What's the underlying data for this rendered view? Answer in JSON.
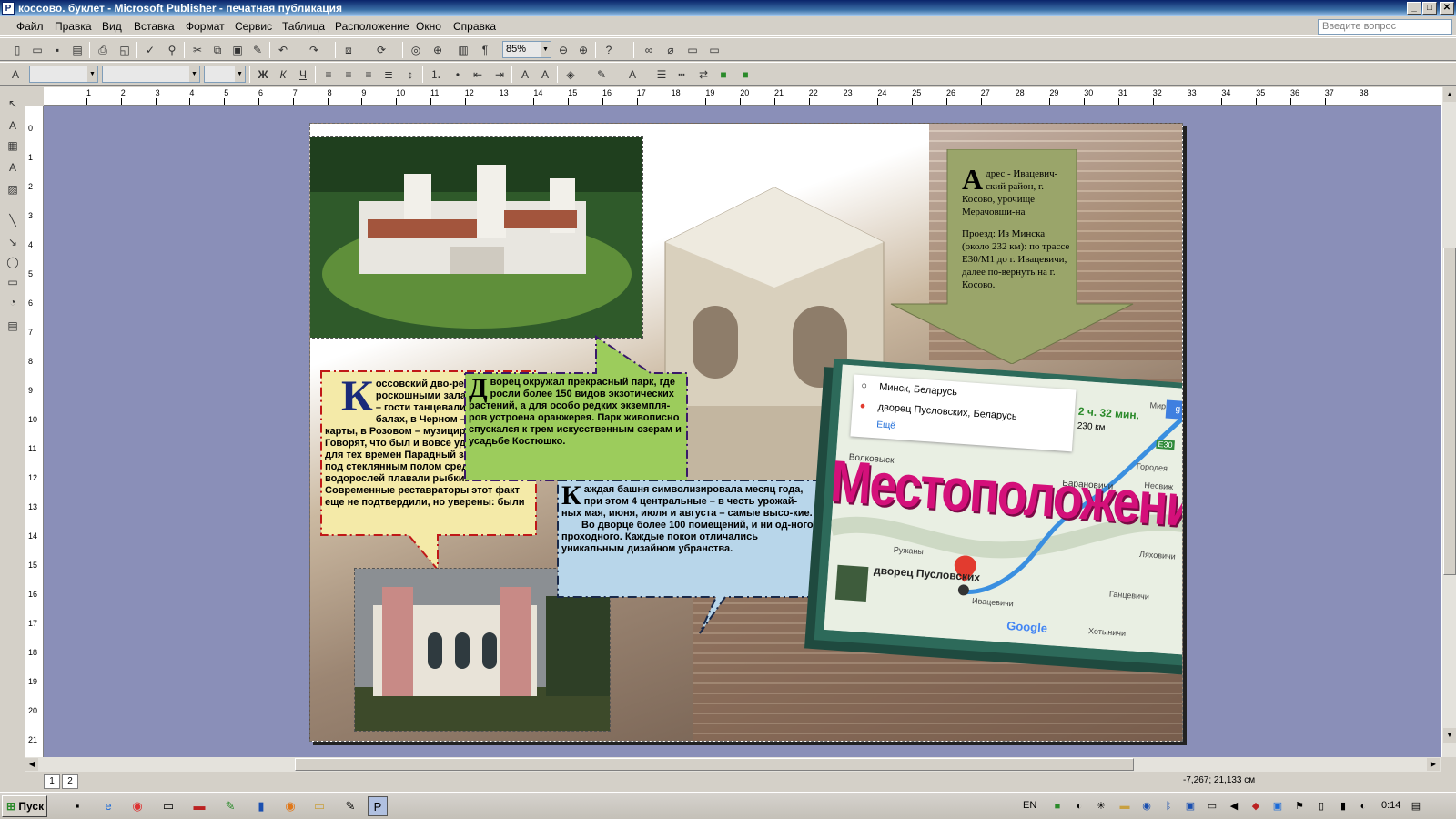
{
  "window": {
    "title": "коссово. буклет - Microsoft Publisher - печатная публикация",
    "app_icon": "publisher-icon"
  },
  "menu": {
    "items": [
      "Файл",
      "Правка",
      "Вид",
      "Вставка",
      "Формат",
      "Сервис",
      "Таблица",
      "Расположение",
      "Окно",
      "Справка"
    ],
    "ask_placeholder": "Введите вопрос"
  },
  "toolbar": {
    "zoom": "85%"
  },
  "rulers": {
    "h": [
      "1",
      "2",
      "3",
      "4",
      "5",
      "6",
      "7",
      "8",
      "9",
      "10",
      "11",
      "12",
      "13",
      "14",
      "15",
      "16",
      "17",
      "18",
      "19",
      "20",
      "21",
      "22",
      "23",
      "24",
      "25",
      "26",
      "27",
      "28",
      "29",
      "30",
      "31",
      "32",
      "33",
      "34",
      "35",
      "36",
      "37",
      "38"
    ],
    "v": [
      "0",
      "1",
      "2",
      "3",
      "4",
      "5",
      "6",
      "7",
      "8",
      "9",
      "10",
      "11",
      "12",
      "13",
      "14",
      "15",
      "16",
      "17",
      "18",
      "19",
      "20",
      "21"
    ]
  },
  "status": {
    "pages": [
      "1",
      "2"
    ],
    "coords": "-7,267; 21,133 см"
  },
  "taskbar": {
    "start": "Пуск",
    "lang": "EN",
    "clock": "0:14"
  },
  "content": {
    "address": {
      "drop": "А",
      "line1": "дрес - Ивацевич-ский район, г. Косово, урочище Мерачовщи-на",
      "line2": "Проезд: Из Минска (около 232 км): по трассе Е30/М1 до г. Ивацевичи, далее по-вернуть на г. Косово."
    },
    "halls": {
      "drop": "К",
      "text": "оссовский дво-рец славился роскошными залами: в Белом – гости танцевали на шумных балах, в Черном – играли в карты, в Розовом – музицировали. Говорят, что был и вовсе удивительный для тех времен Парадный зал, где прямо под стеклянным полом среди водорослей плавали рыбки. Современные реставраторы этот факт еще не подтвердили, но уверены: были"
    },
    "park": {
      "drop": "Д",
      "text": "ворец окружал прекрасный парк, где росли более 150 видов экзотических растений, а для особо редких экземпля-ров устроена оранжерея. Парк живописно спускался к трем искусственным озерам и усадьбе Костюшко."
    },
    "towers": {
      "drop": "К",
      "text1": "аждая башня символизировала месяц года, при этом 4 центральные – в честь урожай-ных мая, июня, июля и августа – самые высо-кие.",
      "text2": "Во дворце более 100 помещений, и ни од-ного проходного. Каждые покои отличались уникальным дизайном убранства."
    },
    "map": {
      "from": "Минск, Беларусь",
      "to": "дворец Пусловских, Беларусь",
      "more": "Ещё",
      "time": "2 ч. 32 мин.",
      "dist": "230 км",
      "title": "Местоположение",
      "google": "Google",
      "pin_label": "дворец Пусловских",
      "places": [
        "Мир",
        "Городея",
        "Несвиж",
        "Барановичи",
        "Волковыск",
        "Ружаны",
        "Ивацевичи",
        "Ганцевичи",
        "Хотыничи",
        "Ляховичи"
      ],
      "road": "E30"
    }
  },
  "colors": {
    "workspace": "#8a8fb8",
    "title_pink": "#d4107a",
    "green_note": "#9ccc5c",
    "yellow_note": "#f4eaa8",
    "blue_note": "#b8d6ea",
    "olive_arrow": "#9aa56a",
    "route": "#3a8fe0"
  }
}
